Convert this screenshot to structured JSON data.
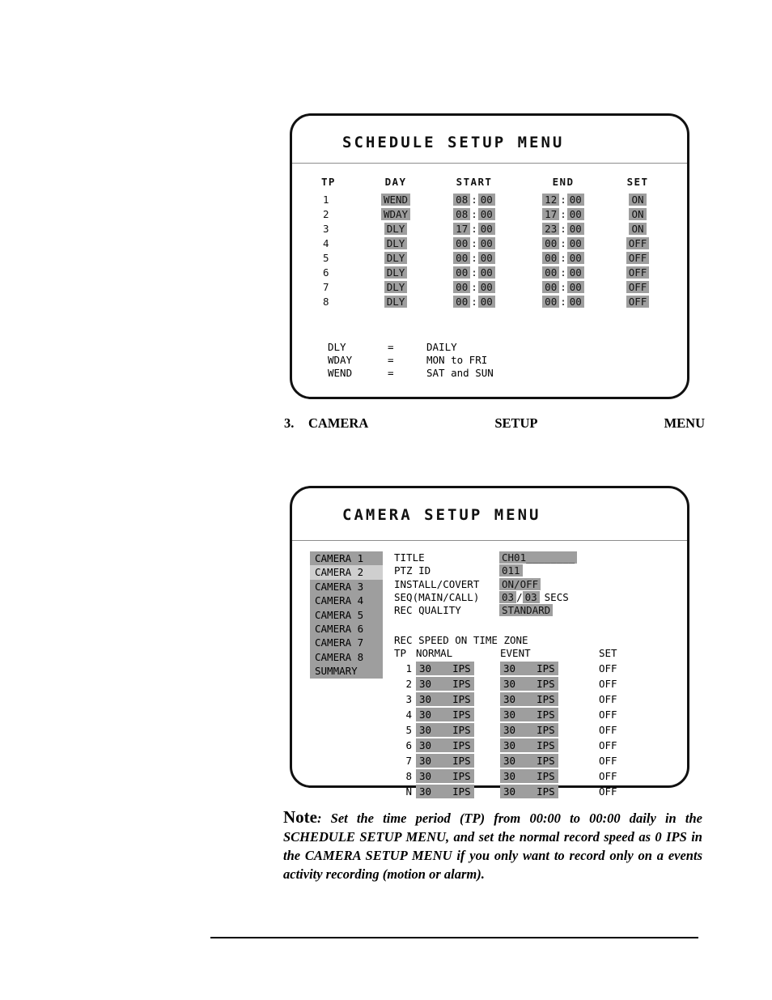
{
  "schedule_menu": {
    "title": "SCHEDULE SETUP MENU",
    "headers": {
      "tp": "TP",
      "day": "DAY",
      "start": "START",
      "end": "END",
      "set": "SET"
    },
    "time_separator": ":",
    "rows": [
      {
        "tp": "1",
        "day": "WEND",
        "start_h": "08",
        "start_m": "00",
        "end_h": "12",
        "end_m": "00",
        "set": "ON"
      },
      {
        "tp": "2",
        "day": "WDAY",
        "start_h": "08",
        "start_m": "00",
        "end_h": "17",
        "end_m": "00",
        "set": "ON"
      },
      {
        "tp": "3",
        "day": "DLY",
        "start_h": "17",
        "start_m": "00",
        "end_h": "23",
        "end_m": "00",
        "set": "ON"
      },
      {
        "tp": "4",
        "day": "DLY",
        "start_h": "00",
        "start_m": "00",
        "end_h": "00",
        "end_m": "00",
        "set": "OFF"
      },
      {
        "tp": "5",
        "day": "DLY",
        "start_h": "00",
        "start_m": "00",
        "end_h": "00",
        "end_m": "00",
        "set": "OFF"
      },
      {
        "tp": "6",
        "day": "DLY",
        "start_h": "00",
        "start_m": "00",
        "end_h": "00",
        "end_m": "00",
        "set": "OFF"
      },
      {
        "tp": "7",
        "day": "DLY",
        "start_h": "00",
        "start_m": "00",
        "end_h": "00",
        "end_m": "00",
        "set": "OFF"
      },
      {
        "tp": "8",
        "day": "DLY",
        "start_h": "00",
        "start_m": "00",
        "end_h": "00",
        "end_m": "00",
        "set": "OFF"
      }
    ],
    "legend": [
      {
        "key": "DLY",
        "eq": "=",
        "value": "DAILY"
      },
      {
        "key": "WDAY",
        "eq": "=",
        "value": "MON to FRI"
      },
      {
        "key": "WEND",
        "eq": "=",
        "value": "SAT and SUN"
      }
    ]
  },
  "step_3": {
    "number": "3.",
    "text": "CAMERA SETUP MENU"
  },
  "camera_menu": {
    "title": "CAMERA SETUP MENU",
    "camera_list": [
      {
        "label": "CAMERA 1",
        "selected": false
      },
      {
        "label": "CAMERA 2",
        "selected": true
      },
      {
        "label": "CAMERA 3",
        "selected": false
      },
      {
        "label": "CAMERA 4",
        "selected": false
      },
      {
        "label": "CAMERA 5",
        "selected": false
      },
      {
        "label": "CAMERA 6",
        "selected": false
      },
      {
        "label": "CAMERA 7",
        "selected": false
      },
      {
        "label": "CAMERA 8",
        "selected": false
      },
      {
        "label": "SUMMARY",
        "selected": false
      }
    ],
    "fields": {
      "title_label": "TITLE",
      "title_value": "CH01________",
      "ptz_label": "PTZ ID",
      "ptz_value": "011",
      "install_label": "INSTALL/COVERT",
      "install_value": "ON/OFF",
      "seq_label": "SEQ(MAIN/CALL)",
      "seq_main": "03",
      "seq_slash": "/",
      "seq_call": "03",
      "seq_units": "SECS",
      "quality_label": "REC QUALITY",
      "quality_value": "STANDARD"
    },
    "rec_speed": {
      "section_title": "REC SPEED ON TIME ZONE",
      "headers": {
        "tp": "TP",
        "normal": "NORMAL",
        "event": "EVENT",
        "set": "SET"
      },
      "rows": [
        {
          "tp": "1",
          "normal": "30",
          "normal_unit": "IPS",
          "event": "30",
          "event_unit": "IPS",
          "set": "OFF"
        },
        {
          "tp": "2",
          "normal": "30",
          "normal_unit": "IPS",
          "event": "30",
          "event_unit": "IPS",
          "set": "OFF"
        },
        {
          "tp": "3",
          "normal": "30",
          "normal_unit": "IPS",
          "event": "30",
          "event_unit": "IPS",
          "set": "OFF"
        },
        {
          "tp": "4",
          "normal": "30",
          "normal_unit": "IPS",
          "event": "30",
          "event_unit": "IPS",
          "set": "OFF"
        },
        {
          "tp": "5",
          "normal": "30",
          "normal_unit": "IPS",
          "event": "30",
          "event_unit": "IPS",
          "set": "OFF"
        },
        {
          "tp": "6",
          "normal": "30",
          "normal_unit": "IPS",
          "event": "30",
          "event_unit": "IPS",
          "set": "OFF"
        },
        {
          "tp": "7",
          "normal": "30",
          "normal_unit": "IPS",
          "event": "30",
          "event_unit": "IPS",
          "set": "OFF"
        },
        {
          "tp": "8",
          "normal": "30",
          "normal_unit": "IPS",
          "event": "30",
          "event_unit": "IPS",
          "set": "OFF"
        },
        {
          "tp": "N",
          "normal": "30",
          "normal_unit": "IPS",
          "event": "30",
          "event_unit": "IPS",
          "set": "OFF"
        }
      ]
    }
  },
  "note": {
    "lead": "Note",
    "text": ": Set the time period (TP) from 00:00 to 00:00 daily in the SCHEDULE SETUP MENU, and set the normal record speed as 0 IPS in the CAMERA SETUP MENU if you only want to record only on a events activity recording (motion or alarm)."
  },
  "colors": {
    "highlight": "#9e9e9e",
    "highlight_selected": "#cfcfcf",
    "border": "#111111",
    "divider": "#8d8d8d",
    "text": "#000000",
    "page_background": "#ffffff"
  }
}
